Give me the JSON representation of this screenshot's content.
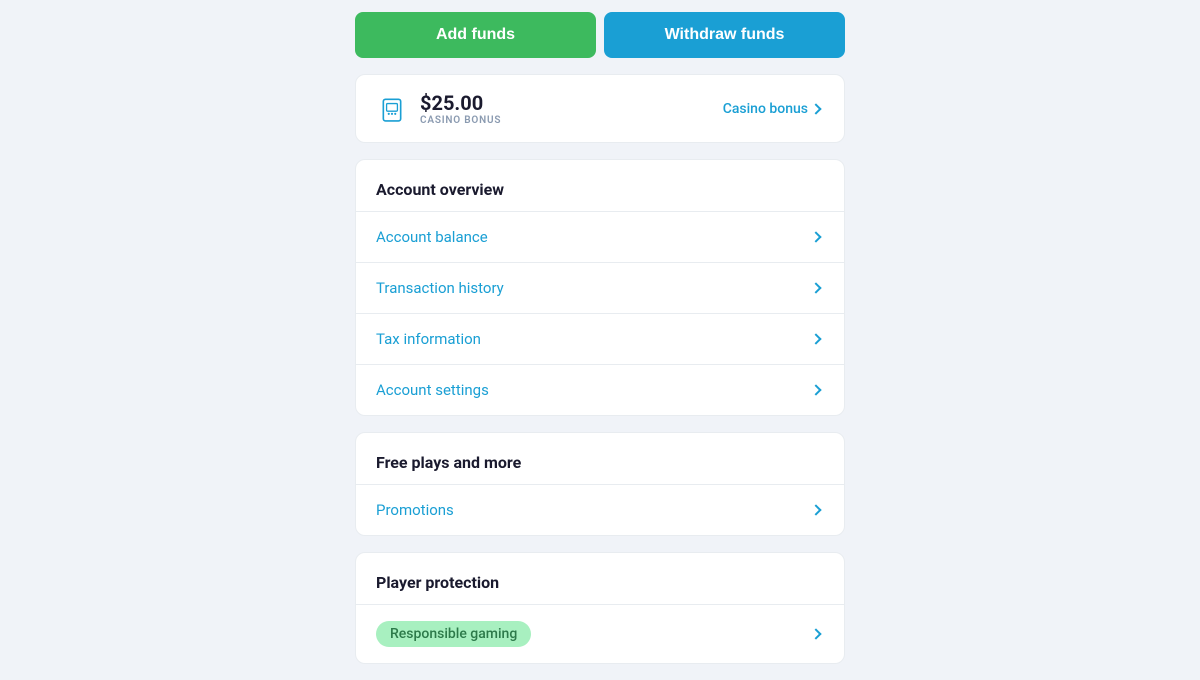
{
  "buttons": {
    "add_funds": "Add funds",
    "withdraw_funds": "Withdraw funds"
  },
  "bonus": {
    "amount": "$25.00",
    "label": "CASINO BONUS",
    "link_text": "Casino bonus"
  },
  "account_overview": {
    "title": "Account overview",
    "items": [
      {
        "label": "Account balance"
      },
      {
        "label": "Transaction history"
      },
      {
        "label": "Tax information"
      },
      {
        "label": "Account settings"
      }
    ]
  },
  "free_plays": {
    "title": "Free plays and more",
    "items": [
      {
        "label": "Promotions"
      }
    ]
  },
  "player_protection": {
    "title": "Player protection",
    "items": [
      {
        "label": "Responsible gaming",
        "badge": true
      }
    ]
  }
}
